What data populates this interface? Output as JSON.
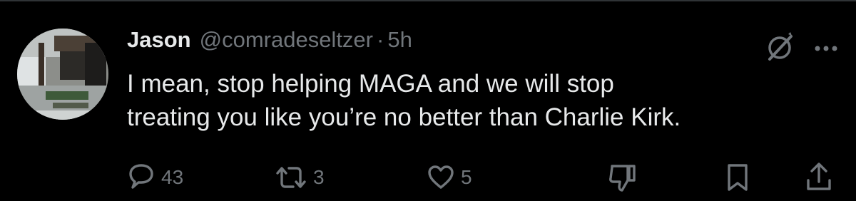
{
  "author": {
    "name": "Jason",
    "handle": "@comradeseltzer",
    "separator": "·",
    "time": "5h"
  },
  "tweet": {
    "text_line1": "I mean, stop helping MAGA and we will stop",
    "text_line2": "treating you like you’re no better than Charlie Kirk."
  },
  "top_icons": [
    "grok-icon",
    "more-icon"
  ],
  "actions": {
    "reply_count": "43",
    "repost_count": "3",
    "like_count": "5"
  },
  "colors": {
    "background": "#000000",
    "primary_text": "#e7e9ea",
    "secondary_text": "#71767b",
    "divider": "#2f3336"
  }
}
